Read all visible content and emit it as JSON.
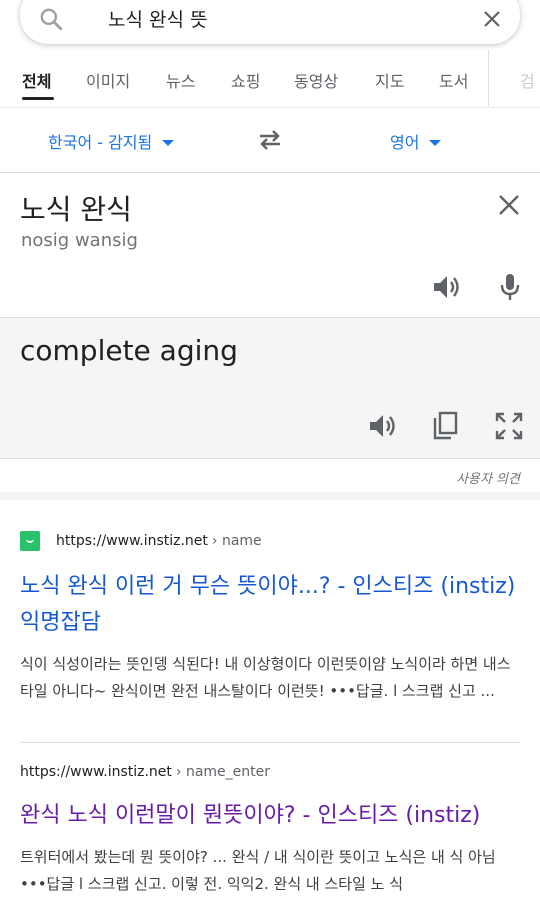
{
  "search": {
    "query": "노식 완식 뜻"
  },
  "tabs": [
    "전체",
    "이미지",
    "뉴스",
    "쇼핑",
    "동영상",
    "지도",
    "도서",
    "검"
  ],
  "translate": {
    "source_lang": "한국어 - 감지됨",
    "target_lang": "영어",
    "source_text": "노식 완식",
    "romanization": "nosig wansig",
    "translation": "complete aging",
    "feedback": "사용자 의견"
  },
  "results": [
    {
      "url": "https://www.instiz.net",
      "path": "› name",
      "title": "노식 완식 이런 거 무슨 뜻이야...? - 인스티즈 (instiz) 익명잡담",
      "snippet": "식이 식성이라는 뜻인뎅 식된다! 내 이상형이다 이런뜻이얌 노식이라 하면 내스타일 아니다~ 완식이면 완전 내스탈이다 이런뜻! •••답글. l 스크랩 신고 ..."
    },
    {
      "url": "https://www.instiz.net",
      "path": "› name_enter",
      "title": "완식 노식 이런말이 뭔뜻이야? - 인스티즈 (instiz)",
      "snippet": "트위터에서 봤는데 뭔 뜻이야? ... 완식 / 내 식이란 뜻이고 노식은 내 식 아님 •••답글 l 스크랩 신고. 이렇 전. 익익2. 완식 내 스타일 노 식"
    }
  ],
  "colors": {
    "link": "#1558d6",
    "visited": "#681da8",
    "accent": "#1a73e8"
  }
}
